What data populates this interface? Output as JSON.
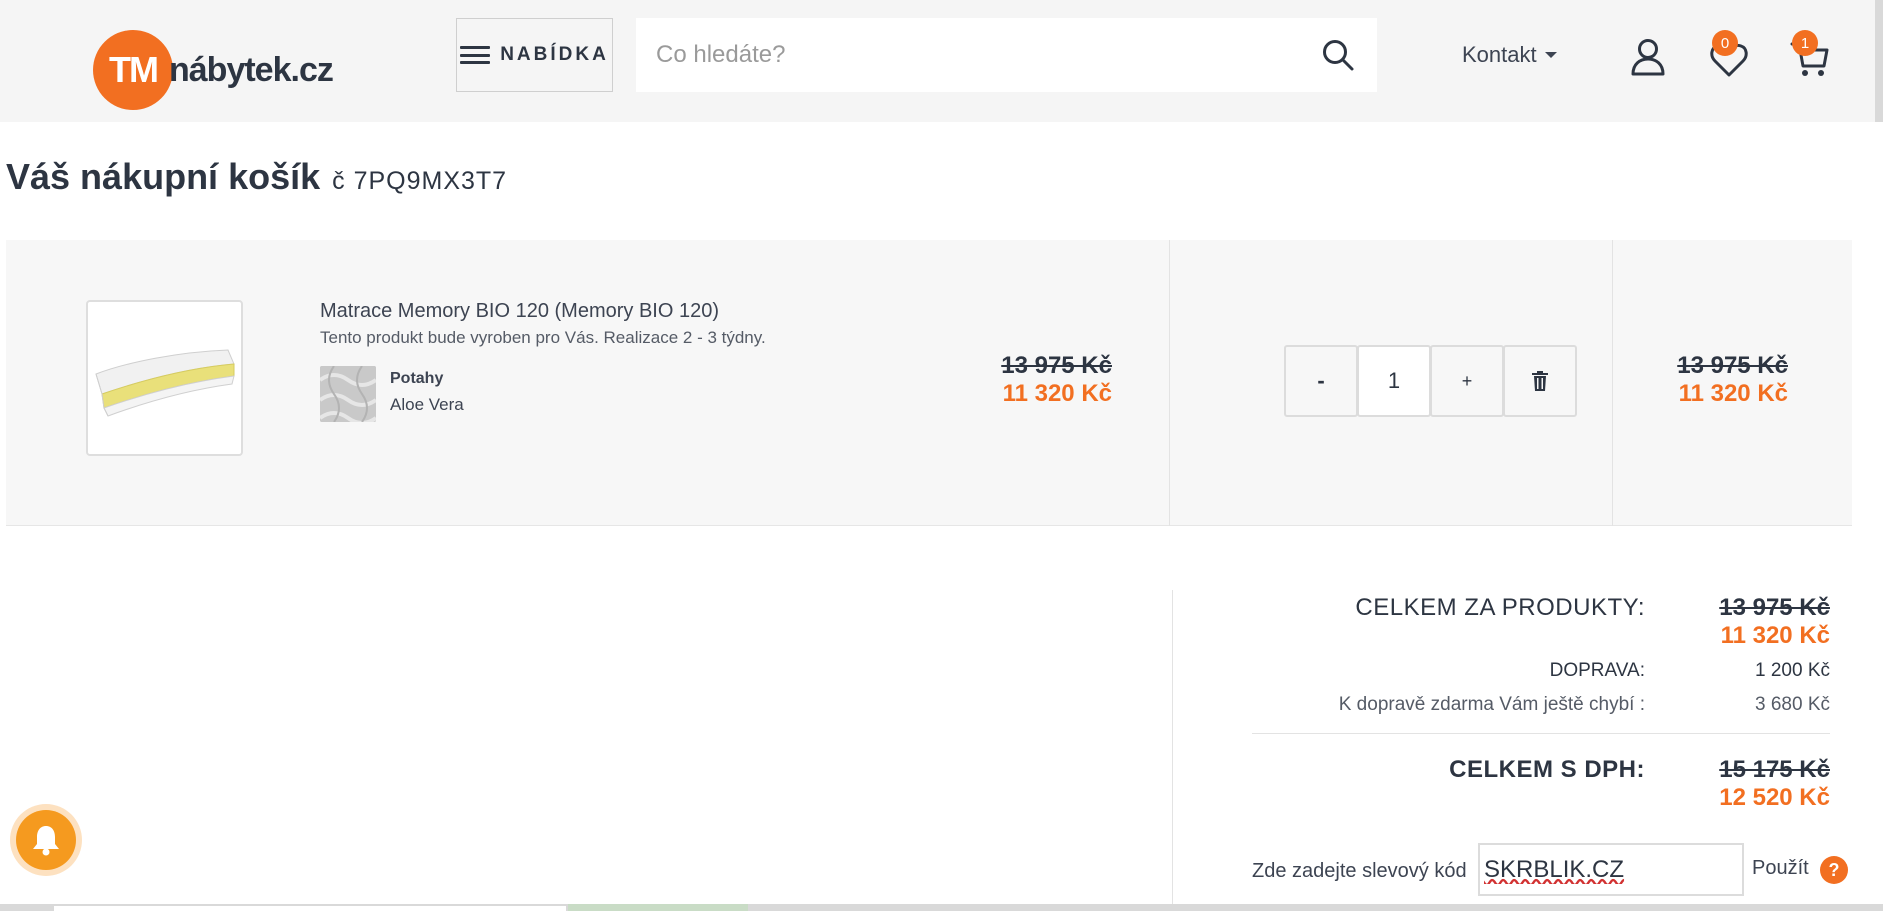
{
  "header": {
    "logo_mark": "TM",
    "logo_text": "nábytek.cz",
    "menu_label": "NABÍDKA",
    "search_placeholder": "Co hledáte?",
    "contact_label": "Kontakt",
    "wishlist_count": "0",
    "cart_count": "1"
  },
  "page": {
    "title": "Váš nákupní košík",
    "order_number": "č 7PQ9MX3T7"
  },
  "cart": {
    "items": [
      {
        "name": "Matrace Memory BIO 120 (Memory BIO 120)",
        "note": "Tento produkt bude vyroben pro Vás. Realizace 2 - 3 týdny.",
        "variant_label": "Potahy",
        "variant_value": "Aloe Vera",
        "unit_price_old": "13 975 Kč",
        "unit_price_new": "11 320 Kč",
        "quantity": "1",
        "minus_label": "-",
        "plus_label": "+",
        "total_old": "13 975 Kč",
        "total_new": "11 320 Kč"
      }
    ]
  },
  "summary": {
    "products_label": "CELKEM ZA PRODUKTY:",
    "products_old": "13 975 Kč",
    "products_new": "11 320 Kč",
    "shipping_label": "DOPRAVA:",
    "shipping_value": "1 200 Kč",
    "free_shipping_label": "K dopravě zdarma Vám ještě chybí :",
    "free_shipping_value": "3 680 Kč",
    "total_label": "CELKEM S DPH:",
    "total_old": "15 175 Kč",
    "total_new": "12 520 Kč",
    "coupon_label": "Zde zadejte slevový kód",
    "coupon_value": "SKRBLIK.CZ",
    "apply_label": "Použít",
    "help_glyph": "?"
  },
  "colors": {
    "accent": "#f26f21",
    "text": "#2d3542",
    "header_bg": "#f5f5f5"
  }
}
